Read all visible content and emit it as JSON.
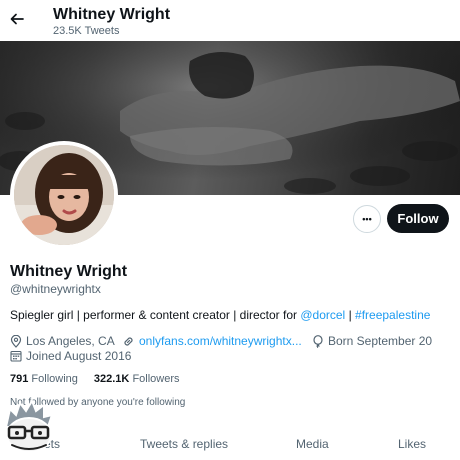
{
  "topbar": {
    "name": "Whitney Wright",
    "tweet_count": "23.5K Tweets",
    "back_icon": "arrow-left-icon"
  },
  "profile": {
    "display_name": "Whitney Wright",
    "handle": "@whitneywrightx",
    "bio": {
      "text": "Spiegler girl | performer & content creator | director for ",
      "mention": "@dorcel",
      "separator": " | ",
      "hashtag": "#freepalestine"
    },
    "location": "Los Angeles, CA",
    "website": "onlyfans.com/whitneywrightx...",
    "birthday": "Born September 20",
    "joined": "Joined August 2016",
    "following_count": "791",
    "following_label": "Following",
    "followers_count": "322.1K",
    "followers_label": "Followers",
    "followed_note": "Not followed by anyone you're following"
  },
  "actions": {
    "more_label": "•••",
    "follow_label": "Follow"
  },
  "tabs": [
    {
      "label": "Tweets"
    },
    {
      "label": "Tweets & replies"
    },
    {
      "label": "Media"
    },
    {
      "label": "Likes"
    }
  ],
  "colors": {
    "accent": "#1d9bf0",
    "text": "#0f1419",
    "muted": "#536471",
    "button_dark": "#0f1419"
  }
}
